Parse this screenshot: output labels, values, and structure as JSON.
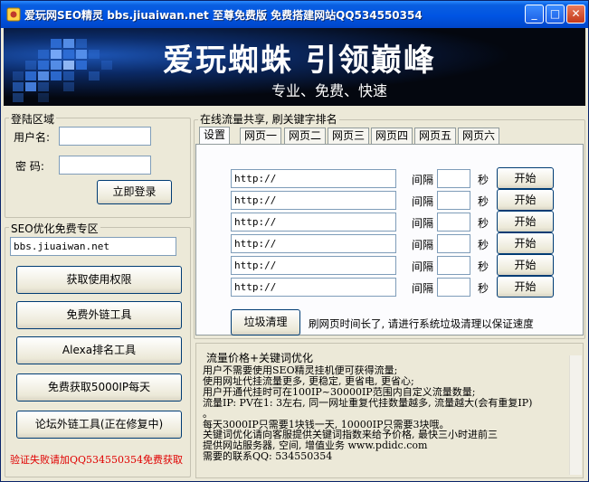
{
  "window": {
    "title": "爱玩网SEO精灵 bbs.jiuaiwan.net 至尊免费版 免费搭建网站QQ534550354",
    "minimize_glyph": "_",
    "maximize_glyph": "□",
    "close_glyph": "✕"
  },
  "banner": {
    "slogan": "爱玩蜘蛛 引领巅峰",
    "subtitle": "专业、免费、快速"
  },
  "login": {
    "group_title": "登陆区域",
    "username_label": "用户名:",
    "username_value": "",
    "password_label": "密  码:",
    "password_value": "",
    "login_button": "立即登录"
  },
  "seo": {
    "group_title": "SEO优化免费专区",
    "site_value": "bbs.jiuaiwan.net",
    "buttons": [
      "获取使用权限",
      "免费外链工具",
      "Alexa排名工具",
      "免费获取5000IP每天",
      "论坛外链工具(正在修复中)"
    ],
    "note": "验证失败请加QQ534550354免费获取"
  },
  "traffic": {
    "group_title": "在线流量共享, 刷关键字排名",
    "tabs": [
      "设置",
      "网页一",
      "网页二",
      "网页三",
      "网页四",
      "网页五",
      "网页六"
    ],
    "url_placeholder": "http://",
    "interval_label": "间隔",
    "seconds_label": "秒",
    "start_label": "开始",
    "rows": [
      {
        "url": "http://",
        "interval": ""
      },
      {
        "url": "http://",
        "interval": ""
      },
      {
        "url": "http://",
        "interval": ""
      },
      {
        "url": "http://",
        "interval": ""
      },
      {
        "url": "http://",
        "interval": ""
      },
      {
        "url": "http://",
        "interval": ""
      }
    ],
    "cleanup_button": "垃圾清理",
    "cleanup_hint": "刷网页时间长了, 请进行系统垃圾清理以保证速度"
  },
  "pricing": {
    "title": "流量价格+关键词优化",
    "lines": [
      "用户不需要使用SEO精灵挂机便可获得流量;",
      "使用网址代挂流量更多, 更稳定, 更省电, 更省心;",
      "用户开通代挂时可在100IP~30000IP范围内自定义流量数量;",
      "流量IP: PV在1: 3左右, 同一网址重复代挂数量越多, 流量越大(会有重复IP)",
      "。",
      "每天3000IP只需要1块钱一天, 10000IP只需要3块哦。",
      "关键词优化请向客服提供关键词指数来给予价格, 最快三小时进前三",
      "提供网站服务器, 空间, 增值业务 www.pdidc.com",
      "需要的联系QQ: 534550354"
    ]
  },
  "colors": {
    "titlebar": "#0054e3",
    "window_bg": "#ece9d8",
    "banner_bg": "#04070f",
    "note_red": "#e00000"
  }
}
